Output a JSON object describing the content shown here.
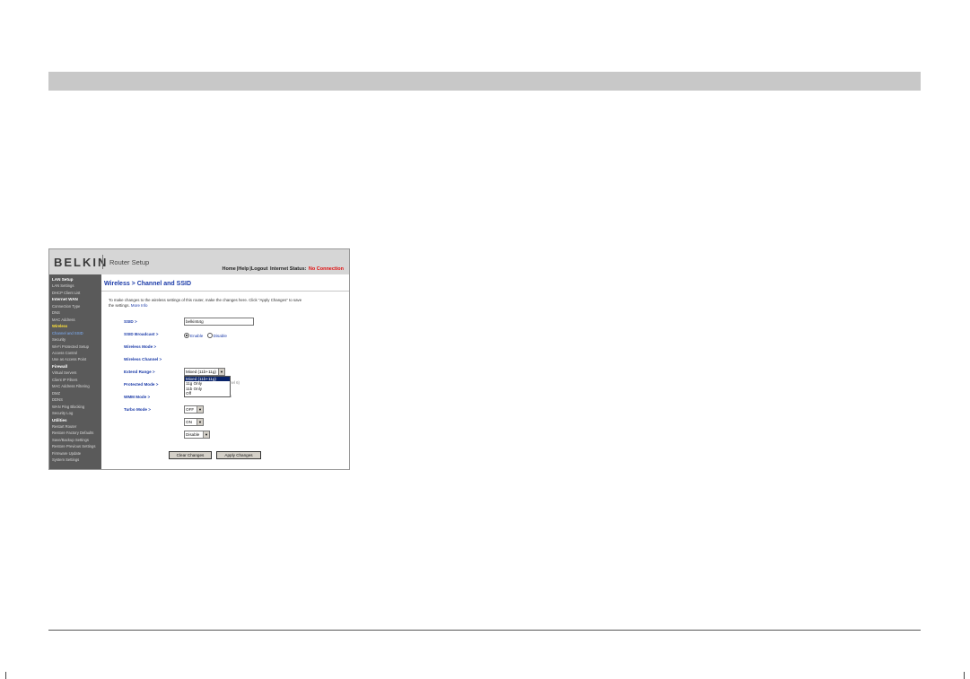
{
  "header": {
    "logo": "BELKIN",
    "app_title": "Router Setup"
  },
  "topnav": {
    "home": "Home",
    "help": "Help",
    "logout": "Logout",
    "status_label": "Internet Status:",
    "status_value": "No Connection"
  },
  "sidebar": [
    {
      "label": "LAN Setup",
      "type": "head"
    },
    {
      "label": "LAN Settings",
      "type": "item"
    },
    {
      "label": "DHCP Client List",
      "type": "item"
    },
    {
      "label": "Internet WAN",
      "type": "head"
    },
    {
      "label": "Connection Type",
      "type": "item"
    },
    {
      "label": "DNS",
      "type": "item"
    },
    {
      "label": "MAC Address",
      "type": "item"
    },
    {
      "label": "Wireless",
      "type": "active"
    },
    {
      "label": "Channel and SSID",
      "type": "hl"
    },
    {
      "label": "Security",
      "type": "item"
    },
    {
      "label": "Wi-Fi Protected Setup",
      "type": "item"
    },
    {
      "label": "Access Control",
      "type": "item"
    },
    {
      "label": "Use as Access Point",
      "type": "item"
    },
    {
      "label": "Firewall",
      "type": "head"
    },
    {
      "label": "Virtual Servers",
      "type": "item"
    },
    {
      "label": "Client IP Filters",
      "type": "item"
    },
    {
      "label": "MAC Address Filtering",
      "type": "item"
    },
    {
      "label": "DMZ",
      "type": "item"
    },
    {
      "label": "DDNS",
      "type": "item"
    },
    {
      "label": "WAN Ping Blocking",
      "type": "item"
    },
    {
      "label": "Security Log",
      "type": "item"
    },
    {
      "label": "Utilities",
      "type": "head"
    },
    {
      "label": "Restart Router",
      "type": "item"
    },
    {
      "label": "Restore Factory Defaults",
      "type": "item"
    },
    {
      "label": "Save/Backup Settings",
      "type": "item"
    },
    {
      "label": "Restore Previous Settings",
      "type": "item"
    },
    {
      "label": "Firmware Update",
      "type": "item"
    },
    {
      "label": "System Settings",
      "type": "item"
    }
  ],
  "page": {
    "title": "Wireless > Channel and SSID",
    "intro": "To make changes to the wireless settings of this router, make the changes here. Click \"Apply Changes\" to save the settings.",
    "more_info": "More Info"
  },
  "form": {
    "ssid_label": "SSID >",
    "ssid_value": "belkin54g",
    "broadcast_label": "SSID Broadcast >",
    "broadcast_enable": "Enable",
    "broadcast_disable": "Disable",
    "mode_label": "Wireless Mode >",
    "mode_value": "Mixed (11b+11g)",
    "mode_options": [
      "Mixed (11b+11g)",
      "11g Only",
      "11b Only",
      "Off"
    ],
    "channel_label": "Wireless Channel >",
    "channel_partial": "nel 6)",
    "extend_label": "Extend Range >",
    "extend_partial": "s",
    "protected_label": "Protected Mode >",
    "protected_value": "OFF",
    "wmm_label": "WMM Mode >",
    "wmm_value": "ON",
    "turbo_label": "Turbo Mode >",
    "turbo_value": "Disable",
    "clear_button": "Clear Changes",
    "apply_button": "Apply Changes"
  }
}
